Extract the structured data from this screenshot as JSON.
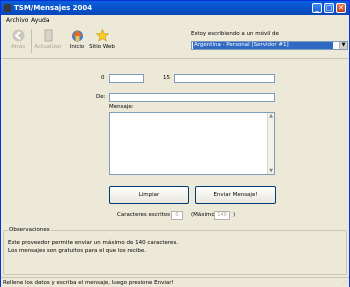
{
  "window": {
    "title": "TSM/Mensajes 2004"
  },
  "menu": {
    "file": "Archivo",
    "help": "Ayuda"
  },
  "toolbar": {
    "back": "Atrás",
    "refresh": "Actualizar",
    "home": "Inicio",
    "website": "Sitio Web"
  },
  "mobile": {
    "label": "Estoy escribiendo a un móvil de",
    "selected": "Argentina - Personal [Servidor #1]"
  },
  "form": {
    "prefix": "0",
    "number_prefix": "15",
    "from_label": "De:",
    "message_label": "Mensaje:",
    "clear_button": "Limpiar",
    "send_button": "Enviar Mensaje!",
    "chars_label": "Caracteres escritos",
    "chars_value": "0",
    "max_open": "(Máximo",
    "max_value": "140",
    "max_close": ")"
  },
  "observations": {
    "legend": "Observaciones",
    "line1": "Este proveedor permite enviar un máximo de 140 caracteres.",
    "line2": "Los mensajes son gratuitos para el que los recibe."
  },
  "status": {
    "text": "Rellene los datos y escriba el mensaje, luego presione Enviar!"
  }
}
